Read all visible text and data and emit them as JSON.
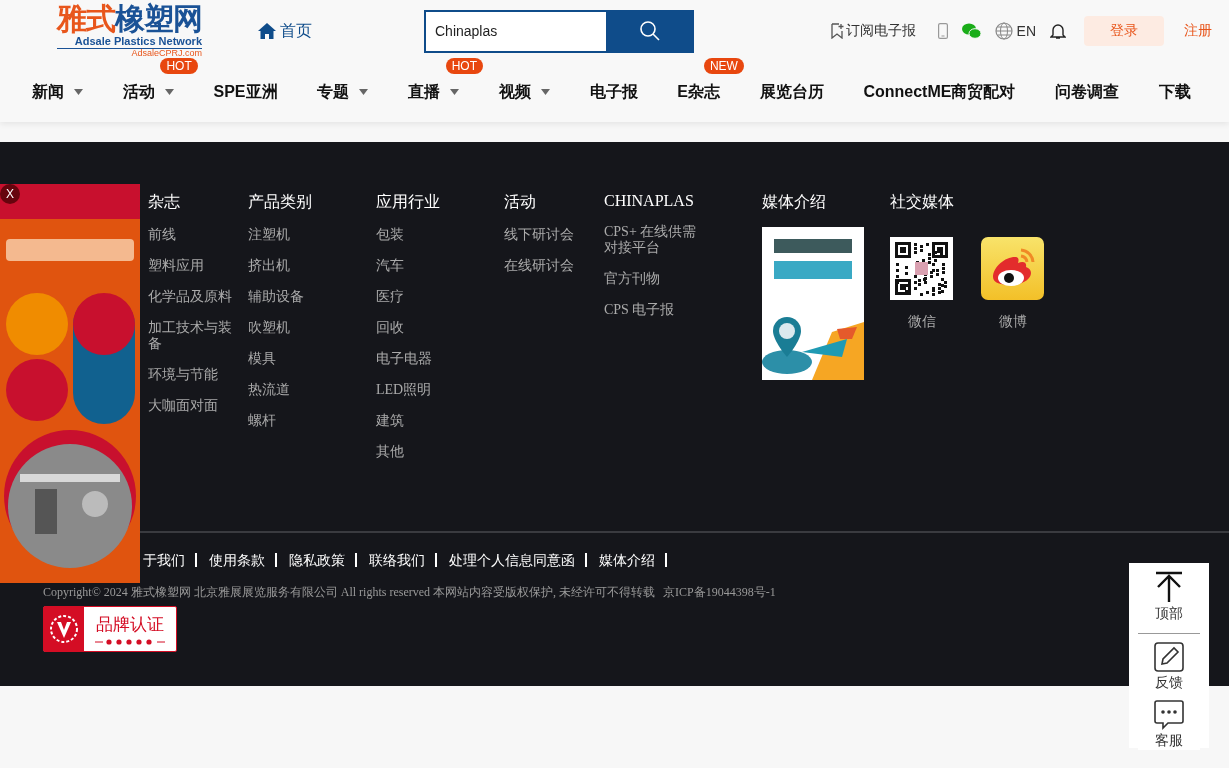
{
  "header": {
    "logo": {
      "brand_a": "雅式",
      "brand_b": "橡塑网",
      "name_en": "Adsale Plastics Network",
      "domain": "AdsaleCPRJ.com"
    },
    "home_link": "首页",
    "search": {
      "value": "Chinaplas"
    },
    "subscribe": "订阅电子报",
    "language": "EN",
    "login": "登录",
    "register": "注册"
  },
  "nav": [
    {
      "label": "新闻",
      "dropdown": true
    },
    {
      "label": "活动",
      "dropdown": true,
      "badge": "HOT"
    },
    {
      "label": "SPE亚洲",
      "dropdown": false
    },
    {
      "label": "专题",
      "dropdown": true
    },
    {
      "label": "直播",
      "dropdown": true,
      "badge": "HOT"
    },
    {
      "label": "视频",
      "dropdown": true
    },
    {
      "label": "电子报",
      "dropdown": false
    },
    {
      "label": "E杂志",
      "dropdown": false,
      "badge": "NEW"
    },
    {
      "label": "展览台历",
      "dropdown": false
    },
    {
      "label": "ConnectME商贸配对",
      "dropdown": false
    },
    {
      "label": "问卷调查",
      "dropdown": false
    },
    {
      "label": "下载",
      "dropdown": false
    }
  ],
  "footer": {
    "columns": [
      {
        "heading": "杂志",
        "links": [
          "前线",
          "塑料应用",
          "化学品及原料",
          "加工技术与装备",
          "环境与节能",
          "大咖面对面"
        ]
      },
      {
        "heading": "产品类别",
        "links": [
          "注塑机",
          "挤出机",
          "辅助设备",
          "吹塑机",
          "模具",
          "热流道",
          "螺杆"
        ]
      },
      {
        "heading": "应用行业",
        "links": [
          "包装",
          "汽车",
          "医疗",
          "回收",
          "电子电器",
          "LED照明",
          "建筑",
          "其他"
        ]
      },
      {
        "heading": "活动",
        "links": [
          "线下研讨会",
          "在线研讨会"
        ]
      },
      {
        "heading": "CHINAPLAS",
        "links": [
          "CPS+ 在线供需对接平台",
          "官方刊物",
          "CPS 电子报"
        ]
      }
    ],
    "media": {
      "heading": "媒体介绍"
    },
    "social": {
      "heading": "社交媒体",
      "accounts": [
        {
          "kind": "qr",
          "label": "微信"
        },
        {
          "kind": "weibo",
          "label": "微博"
        }
      ]
    },
    "bottom_links": [
      "于我们",
      "使用条款",
      "隐私政策",
      "联络我们",
      "处理个人信息同意函",
      "媒体介绍"
    ],
    "copyright": "Copyright© 2024 雅式橡塑网 北京雅展展览服务有限公司 All rights reserved 本网站内容受版权保护, 未经许可不得转载",
    "icp": "京ICP备19044398号-1",
    "badge": {
      "title": "品牌认证"
    }
  },
  "ad": {
    "close": "X"
  },
  "side_tools": [
    {
      "kind": "top",
      "label": "顶部"
    },
    {
      "kind": "feedback",
      "label": "反馈"
    },
    {
      "kind": "service",
      "label": "客服"
    }
  ]
}
